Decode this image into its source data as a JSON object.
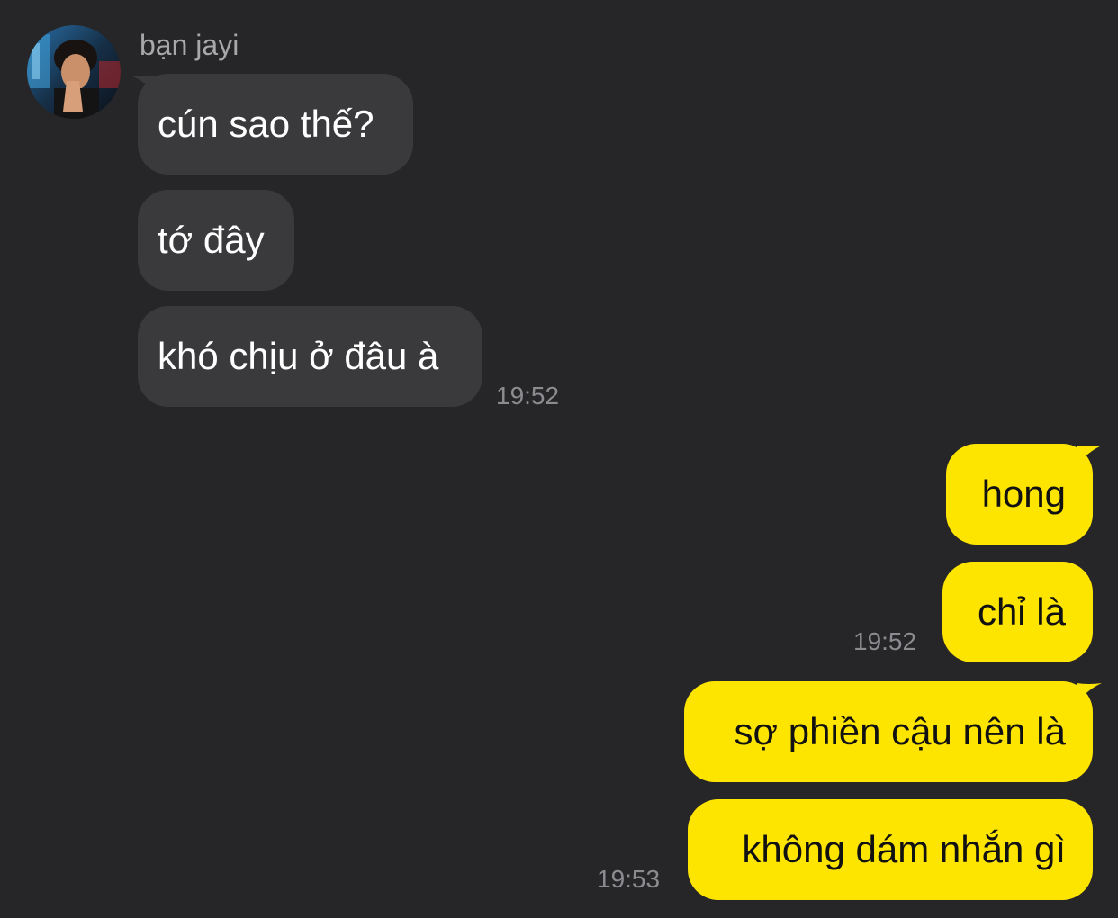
{
  "conversation": {
    "sender": {
      "name": "bạn jayi",
      "avatar": "avatar-photo"
    },
    "incoming": [
      {
        "text": "cún sao thế?"
      },
      {
        "text": "tớ đây"
      },
      {
        "text": "khó chịu ở đâu à"
      }
    ],
    "incoming_time": "19:52",
    "outgoing_group_1": [
      {
        "text": "hong"
      },
      {
        "text": "chỉ là"
      }
    ],
    "outgoing_time_1": "19:52",
    "outgoing_group_2": [
      {
        "text": "sợ phiền cậu nên là"
      },
      {
        "text": "không dám nhắn gì"
      }
    ],
    "outgoing_time_2": "19:53"
  },
  "colors": {
    "background": "#262628",
    "incoming_bubble": "#3a3a3c",
    "outgoing_bubble": "#fee500",
    "timestamp": "#8c8c90",
    "sender_name": "#a8a8ab"
  }
}
